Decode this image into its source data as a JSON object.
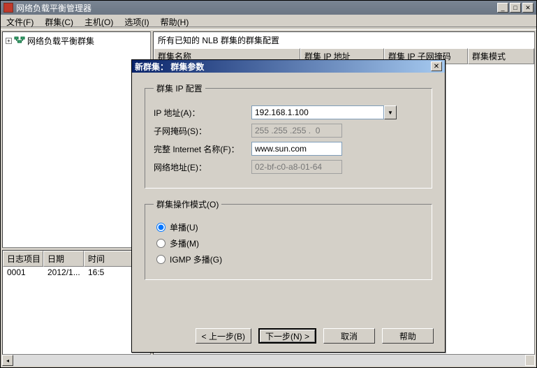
{
  "window": {
    "title": "网络负载平衡管理器",
    "menu": {
      "file": "文件(F)",
      "cluster": "群集(C)",
      "host": "主机(O)",
      "options": "选项(I)",
      "help": "帮助(H)"
    }
  },
  "tree": {
    "root": "网络负载平衡群集",
    "expand": "+"
  },
  "rightpane": {
    "heading": "所有已知的 NLB 群集的群集配置",
    "cols": {
      "name": "群集名称",
      "ip": "群集 IP 地址",
      "mask": "群集 IP 子网掩码",
      "mode": "群集模式"
    }
  },
  "log": {
    "cols": {
      "item": "日志项目",
      "date": "日期",
      "time": "时间"
    },
    "row": {
      "item": "0001",
      "date": "2012/1...",
      "time": "16:5"
    }
  },
  "dialog": {
    "title": "新群集：  群集参数",
    "group_ip": "群集 IP 配置",
    "ip_label": "IP 地址(A)：",
    "ip_value": "192.168.1.100",
    "mask_label": "子网掩码(S)：",
    "mask_value": "255 .255 .255 .  0",
    "fqdn_label": "完整 Internet 名称(F)：",
    "fqdn_value": "www.sun.com",
    "mac_label": "网络地址(E)：",
    "mac_value": "02-bf-c0-a8-01-64",
    "group_mode": "群集操作模式(O)",
    "mode_unicast": "单播(U)",
    "mode_multicast": "多播(M)",
    "mode_igmp": "IGMP 多播(G)",
    "btn_back": "< 上一步(B)",
    "btn_next": "下一步(N) >",
    "btn_cancel": "取消",
    "btn_help": "帮助"
  }
}
